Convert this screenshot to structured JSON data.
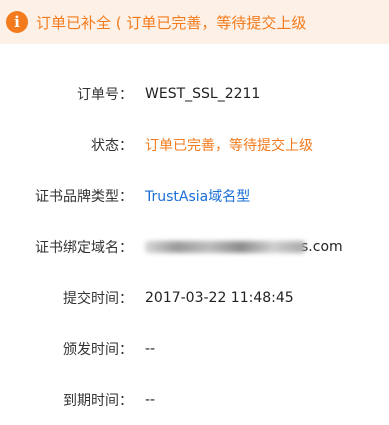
{
  "banner": {
    "icon": "info-icon",
    "icon_glyph": "i",
    "text": "订单已补全 ( 订单已完善，等待提交上级",
    "accent_color": "#f37b1d"
  },
  "fields": [
    {
      "label": "订单号：",
      "value": "WEST_SSL_2211"
    },
    {
      "label": "状态：",
      "value": "订单已完善，等待提交上级"
    },
    {
      "label": "证书品牌类型：",
      "value": "TrustAsia域名型"
    },
    {
      "label": "证书绑定域名：",
      "value_suffix": "s.com"
    },
    {
      "label": "提交时间：",
      "value": "2017-03-22 11:48:45"
    },
    {
      "label": "颁发时间：",
      "value": "--"
    },
    {
      "label": "到期时间：",
      "value": "--"
    }
  ]
}
